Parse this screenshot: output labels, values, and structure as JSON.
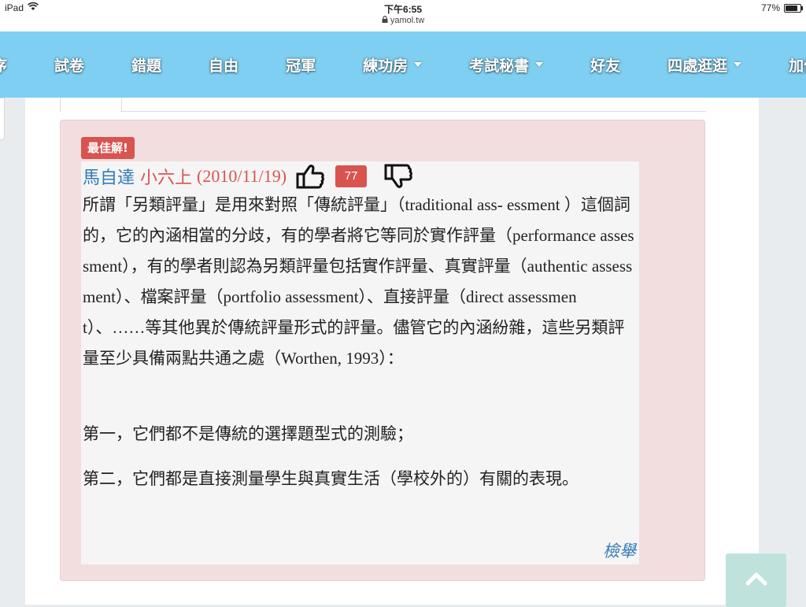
{
  "status_bar": {
    "device": "iPad",
    "time": "下午6:55",
    "url": "yamol.tw",
    "battery": "77%",
    "battery_level": 0.77
  },
  "nav": {
    "items": [
      {
        "label": "序",
        "caret": false
      },
      {
        "label": "試卷",
        "caret": false
      },
      {
        "label": "錯題",
        "caret": false
      },
      {
        "label": "自由",
        "caret": false
      },
      {
        "label": "冠軍",
        "caret": false
      },
      {
        "label": "練功房",
        "caret": true
      },
      {
        "label": "考試秘書",
        "caret": true
      },
      {
        "label": "好友",
        "caret": false
      },
      {
        "label": "四處逛逛",
        "caret": true
      },
      {
        "label": "加值服",
        "caret": false
      }
    ],
    "bg_color": "#7ecff1"
  },
  "answer": {
    "badge": "最佳解!",
    "author": "馬自達",
    "grade": "小六上",
    "date": "(2010/11/19)",
    "votes": "77",
    "body": "所謂「另類評量」是用來對照「傳統評量」（traditional ass- essment ）這個詞的，它的內涵相當的分歧，有的學者將它等同於實作評量（performance assessment），有的學者則認為另類評量包括實作評量、真實評量（authentic assessment）、檔案評量（portfolio assessment）、直接評量（direct assessment）、……等其他異於傳統評量形式的評量。儘管它的內涵紛雜，這些另類評量至少具備兩點共通之處（Worthen, 1993）：",
    "point1": "第一，它們都不是傳統的選擇題型式的測驗；",
    "point2": "第二，它們都是直接測量學生與真實生活（學校外的）有關的表現。",
    "report": "檢舉"
  },
  "colors": {
    "accent_red": "#d9534f",
    "link_blue": "#337ab7",
    "panel_pink": "#f2dede"
  }
}
